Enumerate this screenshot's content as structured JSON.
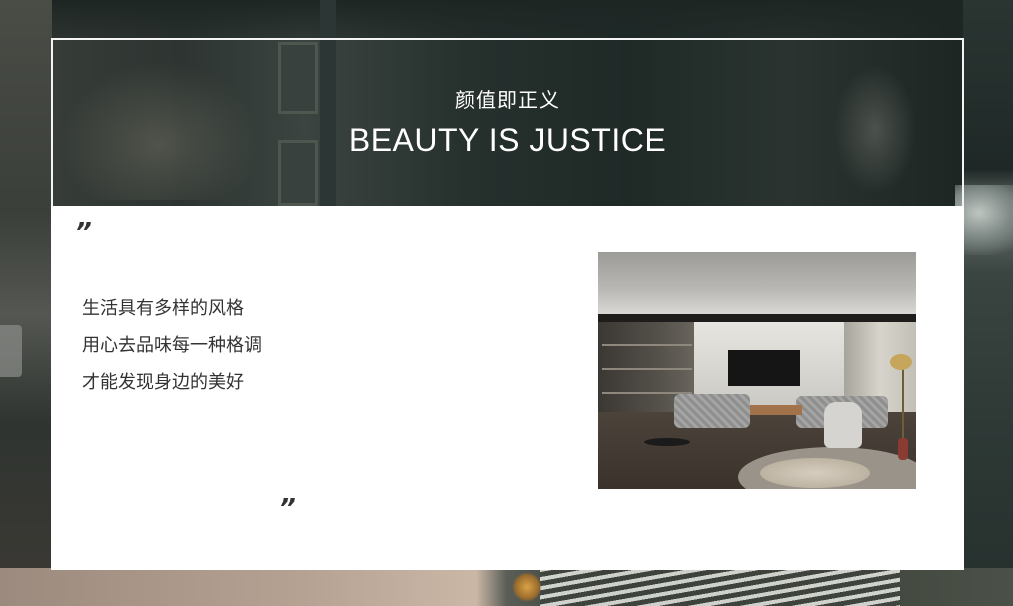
{
  "header": {
    "subtitle": "颜值即正义",
    "title": "BEAUTY IS JUSTICE"
  },
  "content": {
    "quote_open": "”",
    "quote_close": "”",
    "lines": [
      "生活具有多样的风格",
      "用心去品味每一种格调",
      "才能发现身边的美好"
    ]
  },
  "colors": {
    "panel": "#ffffff",
    "text": "#333333",
    "header_text": "#ffffff",
    "frame": "#f4f4f4"
  },
  "icons": {
    "quote": "quotation-mark"
  }
}
